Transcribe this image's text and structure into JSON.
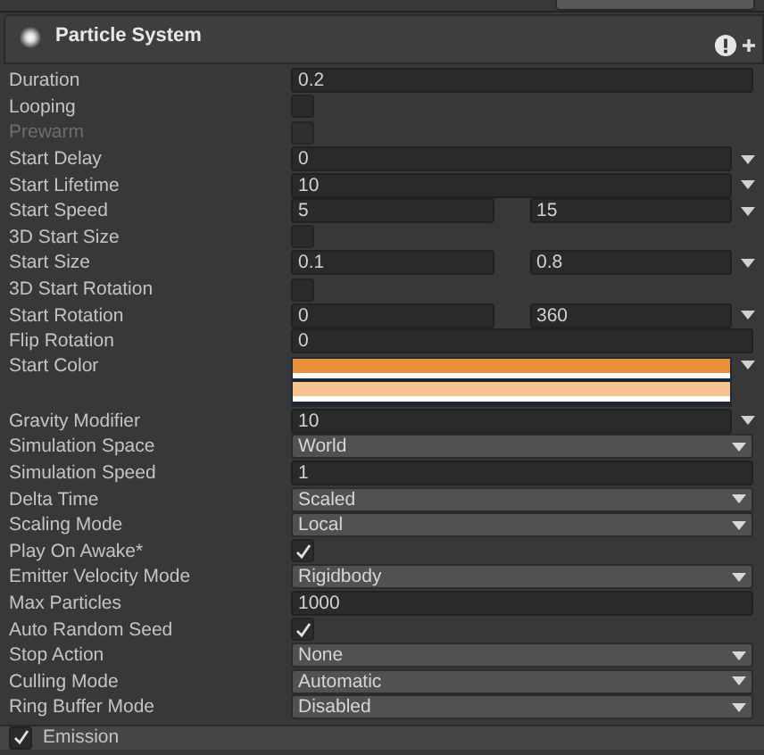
{
  "component": {
    "title": "Particle System"
  },
  "properties": [
    {
      "kind": "float",
      "label": "Duration",
      "value": "0.2",
      "menu": false
    },
    {
      "kind": "toggle",
      "label": "Looping",
      "checked": false,
      "disabled": false
    },
    {
      "kind": "toggle",
      "label": "Prewarm",
      "checked": false,
      "disabled": true
    },
    {
      "kind": "float",
      "label": "Start Delay",
      "value": "0",
      "menu": true
    },
    {
      "kind": "float",
      "label": "Start Lifetime",
      "value": "10",
      "menu": true
    },
    {
      "kind": "range",
      "label": "Start Speed",
      "min": "5",
      "max": "15",
      "menu": true
    },
    {
      "kind": "toggle",
      "label": "3D Start Size",
      "checked": false,
      "disabled": false
    },
    {
      "kind": "range",
      "label": "Start Size",
      "min": "0.1",
      "max": "0.8",
      "menu": true
    },
    {
      "kind": "toggle",
      "label": "3D Start Rotation",
      "checked": false,
      "disabled": false
    },
    {
      "kind": "range",
      "label": "Start Rotation",
      "min": "0",
      "max": "360",
      "menu": true
    },
    {
      "kind": "float",
      "label": "Flip Rotation",
      "value": "0",
      "menu": false
    },
    {
      "kind": "gradient",
      "label": "Start Color",
      "swatches": [
        {
          "color": "#e8913a"
        },
        {
          "color": "#f7c390"
        }
      ],
      "menu": true
    },
    {
      "kind": "float",
      "label": "Gravity Modifier",
      "value": "10",
      "menu": true
    },
    {
      "kind": "dropdown",
      "label": "Simulation Space",
      "value": "World"
    },
    {
      "kind": "float",
      "label": "Simulation Speed",
      "value": "1",
      "menu": false
    },
    {
      "kind": "dropdown",
      "label": "Delta Time",
      "value": "Scaled"
    },
    {
      "kind": "dropdown",
      "label": "Scaling Mode",
      "value": "Local"
    },
    {
      "kind": "toggle",
      "label": "Play On Awake*",
      "checked": true,
      "disabled": false
    },
    {
      "kind": "dropdown",
      "label": "Emitter Velocity Mode",
      "value": "Rigidbody"
    },
    {
      "kind": "float",
      "label": "Max Particles",
      "value": "1000",
      "menu": false
    },
    {
      "kind": "toggle",
      "label": "Auto Random Seed",
      "checked": true,
      "disabled": false
    },
    {
      "kind": "dropdown",
      "label": "Stop Action",
      "value": "None"
    },
    {
      "kind": "dropdown",
      "label": "Culling Mode",
      "value": "Automatic"
    },
    {
      "kind": "dropdown",
      "label": "Ring Buffer Mode",
      "value": "Disabled"
    }
  ],
  "next_module": {
    "title": "Emission",
    "checked": true
  }
}
